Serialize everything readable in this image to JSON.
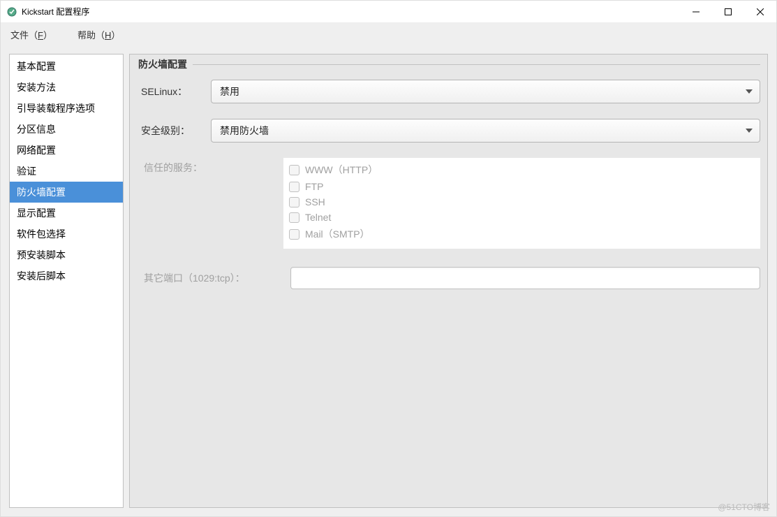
{
  "window": {
    "title": "Kickstart 配置程序"
  },
  "menubar": {
    "file_prefix": "文件（",
    "file_accel": "F",
    "file_suffix": "）",
    "help_prefix": "帮助（",
    "help_accel": "H",
    "help_suffix": "）"
  },
  "sidebar": {
    "items": [
      {
        "label": "基本配置"
      },
      {
        "label": "安装方法"
      },
      {
        "label": "引导装载程序选项"
      },
      {
        "label": "分区信息"
      },
      {
        "label": "网络配置"
      },
      {
        "label": "验证"
      },
      {
        "label": "防火墙配置"
      },
      {
        "label": "显示配置"
      },
      {
        "label": "软件包选择"
      },
      {
        "label": "预安装脚本"
      },
      {
        "label": "安装后脚本"
      }
    ],
    "selected_index": 6
  },
  "panel": {
    "title": "防火墙配置",
    "selinux_label": "SELinux：",
    "selinux_value": "禁用",
    "security_label": "安全级别：",
    "security_value": "禁用防火墙",
    "services_label": "信任的服务：",
    "services": [
      {
        "label": "WWW（HTTP）"
      },
      {
        "label": "FTP"
      },
      {
        "label": "SSH"
      },
      {
        "label": "Telnet"
      },
      {
        "label": "Mail（SMTP）"
      }
    ],
    "ports_label": "其它端口（1029:tcp）：",
    "ports_value": ""
  },
  "watermark": "@51CTO博客"
}
